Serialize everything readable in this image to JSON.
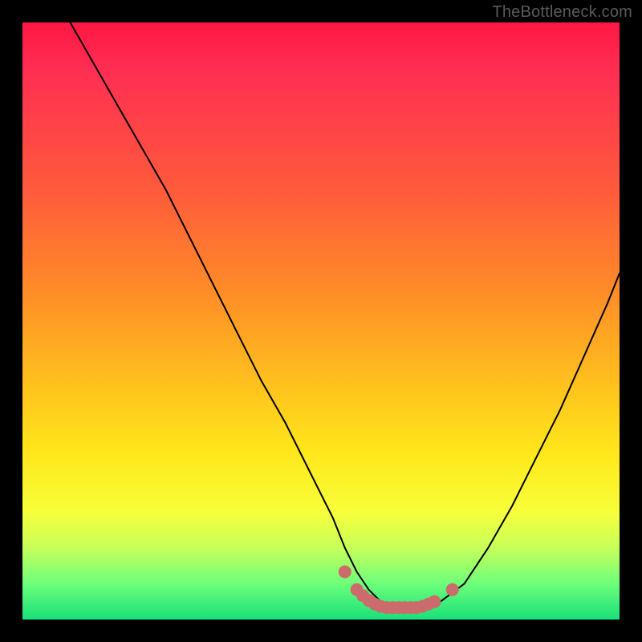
{
  "watermark": "TheBottleneck.com",
  "chart_data": {
    "type": "line",
    "title": "",
    "xlabel": "",
    "ylabel": "",
    "xlim": [
      0,
      100
    ],
    "ylim": [
      0,
      100
    ],
    "series": [
      {
        "name": "bottleneck-curve",
        "color": "#000000",
        "stroke_width": 2,
        "x": [
          8,
          12,
          16,
          20,
          24,
          28,
          32,
          36,
          40,
          44,
          48,
          50,
          52,
          54,
          56,
          58,
          60,
          62,
          64,
          66,
          68,
          70,
          74,
          78,
          82,
          86,
          90,
          94,
          98,
          100
        ],
        "y": [
          100,
          93,
          86,
          79,
          72,
          64,
          56,
          48,
          40,
          33,
          25,
          21,
          17,
          12,
          8,
          5,
          3,
          2,
          2,
          2,
          2,
          3,
          6,
          12,
          19,
          27,
          35,
          44,
          53,
          58
        ]
      },
      {
        "name": "sweet-spot-markers",
        "color": "#cc6b6b",
        "marker_radius": 8,
        "x": [
          54,
          56,
          57,
          58,
          59,
          60,
          61,
          62,
          63,
          64,
          65,
          66,
          67,
          68,
          69,
          72
        ],
        "y": [
          8,
          5,
          4,
          3.2,
          2.6,
          2.2,
          2,
          2,
          2,
          2,
          2,
          2,
          2.2,
          2.6,
          3,
          5
        ]
      }
    ]
  }
}
